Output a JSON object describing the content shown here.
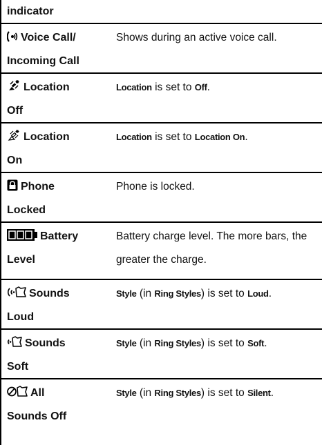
{
  "header": {
    "label": "indicator"
  },
  "rows": [
    {
      "icon": "voice-call-icon",
      "name1": "Voice Call/",
      "name2": "Incoming Call",
      "desc": [
        {
          "text": "Shows during an active voice call.",
          "cond": false
        }
      ]
    },
    {
      "icon": "location-off-icon",
      "name1": "Location",
      "name2": "Off",
      "desc": [
        {
          "text": "Location",
          "cond": true
        },
        {
          "text": " is set to ",
          "cond": false
        },
        {
          "text": "Off",
          "cond": true
        },
        {
          "text": ".",
          "cond": false
        }
      ]
    },
    {
      "icon": "location-on-icon",
      "name1": "Location",
      "name2": "On",
      "desc": [
        {
          "text": "Location",
          "cond": true
        },
        {
          "text": " is set to ",
          "cond": false
        },
        {
          "text": "Location On",
          "cond": true
        },
        {
          "text": ".",
          "cond": false
        }
      ]
    },
    {
      "icon": "phone-locked-icon",
      "name1": "Phone",
      "name2": "Locked",
      "desc": [
        {
          "text": "Phone is locked.",
          "cond": false
        }
      ]
    },
    {
      "icon": "battery-level-icon",
      "name1": "Battery",
      "name2": "Level",
      "desc": [
        {
          "text": "Battery charge level. The more bars, the greater the charge.",
          "cond": false
        }
      ]
    },
    {
      "icon": "sounds-loud-icon",
      "name1": "Sounds",
      "name2": "Loud",
      "desc": [
        {
          "text": "Style",
          "cond": true
        },
        {
          "text": " (in ",
          "cond": false
        },
        {
          "text": "Ring Styles",
          "cond": true
        },
        {
          "text": ") is set to ",
          "cond": false
        },
        {
          "text": "Loud",
          "cond": true
        },
        {
          "text": ".",
          "cond": false
        }
      ]
    },
    {
      "icon": "sounds-soft-icon",
      "name1": "Sounds",
      "name2": "Soft",
      "desc": [
        {
          "text": "Style",
          "cond": true
        },
        {
          "text": " (in ",
          "cond": false
        },
        {
          "text": "Ring Styles",
          "cond": true
        },
        {
          "text": ") is set to ",
          "cond": false
        },
        {
          "text": "Soft",
          "cond": true
        },
        {
          "text": ".",
          "cond": false
        }
      ]
    },
    {
      "icon": "all-sounds-off-icon",
      "name1": "All",
      "name2": "Sounds Off",
      "desc": [
        {
          "text": "Style",
          "cond": true
        },
        {
          "text": " (in ",
          "cond": false
        },
        {
          "text": "Ring Styles",
          "cond": true
        },
        {
          "text": ") is set to ",
          "cond": false
        },
        {
          "text": "Silent",
          "cond": true
        },
        {
          "text": ".",
          "cond": false
        }
      ]
    }
  ]
}
